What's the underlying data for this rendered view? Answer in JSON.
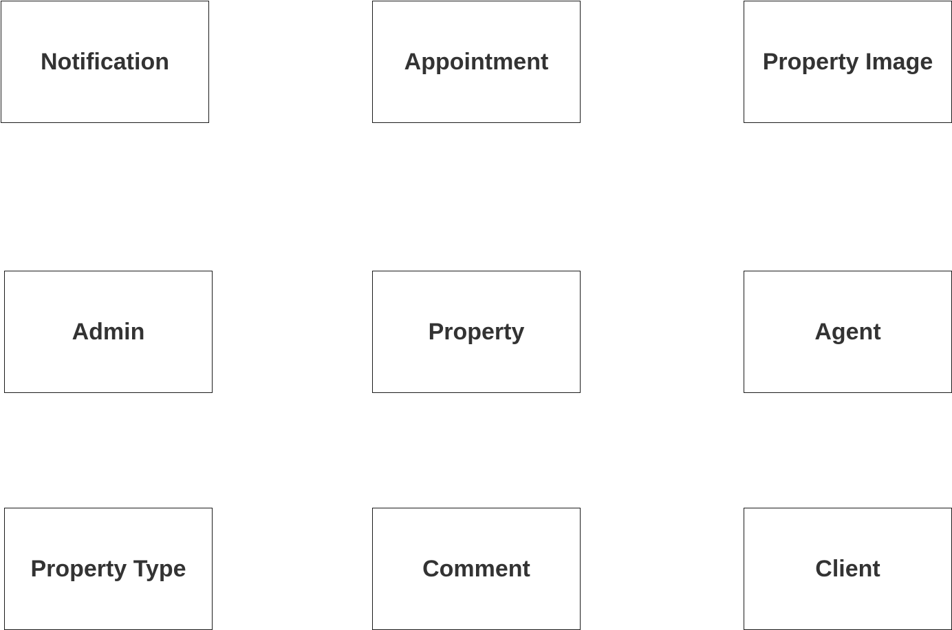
{
  "diagram": {
    "type": "entity-diagram",
    "entities": [
      {
        "name": "Notification"
      },
      {
        "name": "Appointment"
      },
      {
        "name": "Property Image"
      },
      {
        "name": "Admin"
      },
      {
        "name": "Property"
      },
      {
        "name": "Agent"
      },
      {
        "name": "Property Type"
      },
      {
        "name": "Comment"
      },
      {
        "name": "Client"
      }
    ],
    "colors": {
      "text": "#333333",
      "border": "#1a1a1a",
      "background": "#ffffff"
    }
  }
}
